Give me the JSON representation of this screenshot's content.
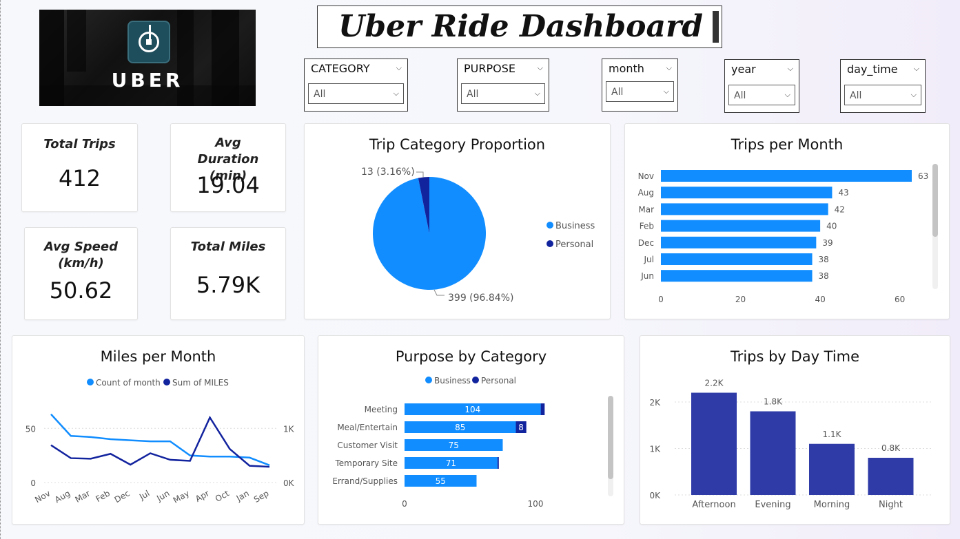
{
  "app": {
    "title": "Uber Ride Dashboard",
    "logo_text": "UBER"
  },
  "slicers": [
    {
      "label": "CATEGORY",
      "value": "All"
    },
    {
      "label": "PURPOSE",
      "value": "All"
    },
    {
      "label": "month",
      "value": "All"
    },
    {
      "label": "year",
      "value": "All"
    },
    {
      "label": "day_time",
      "value": "All"
    }
  ],
  "kpis": {
    "total_trips": {
      "label": "Total Trips",
      "value": "412"
    },
    "avg_duration": {
      "label": "Avg Duration (min)",
      "value": "19.04"
    },
    "avg_speed": {
      "label": "Avg Speed (km/h)",
      "value": "50.62"
    },
    "total_miles": {
      "label": "Total Miles",
      "value": "5.79K"
    }
  },
  "colors": {
    "business": "#118dff",
    "personal": "#12239e",
    "daytime_bar": "#2f3ca8"
  },
  "icons": {
    "dropdown": "chevron-down-icon",
    "logo": "uber-logo-icon"
  },
  "chart_data": [
    {
      "id": "trip_category",
      "type": "pie",
      "title": "Trip Category Proportion",
      "slices": [
        {
          "name": "Business",
          "value": 399,
          "label": "399 (96.84%)"
        },
        {
          "name": "Personal",
          "value": 13,
          "label": "13 (3.16%)"
        }
      ],
      "legend": [
        "Business",
        "Personal"
      ],
      "legend_position": "right"
    },
    {
      "id": "trips_per_month",
      "type": "bar",
      "orientation": "horizontal",
      "title": "Trips per Month",
      "categories": [
        "Nov",
        "Aug",
        "Mar",
        "Feb",
        "Dec",
        "Jul",
        "Jun"
      ],
      "values": [
        63,
        43,
        42,
        40,
        39,
        38,
        38
      ],
      "xticks": [
        "0",
        "20",
        "40",
        "60"
      ],
      "xlim": [
        0,
        63
      ]
    },
    {
      "id": "miles_per_month",
      "type": "line",
      "title": "Miles per Month",
      "legend": [
        "Count of month",
        "Sum of MILES"
      ],
      "legend_position": "top",
      "categories": [
        "Nov",
        "Aug",
        "Mar",
        "Feb",
        "Dec",
        "Jul",
        "Jun",
        "May",
        "Apr",
        "Oct",
        "Jan",
        "Sep"
      ],
      "series": [
        {
          "name": "Count of month",
          "axis": "left",
          "values": [
            63,
            43,
            42,
            40,
            39,
            38,
            38,
            25,
            24,
            24,
            23,
            16
          ]
        },
        {
          "name": "Sum of MILES",
          "axis": "right",
          "values": [
            690,
            450,
            440,
            530,
            330,
            540,
            420,
            400,
            1200,
            620,
            310,
            290
          ]
        }
      ],
      "yticks_left": [
        "0",
        "50"
      ],
      "yticks_right": [
        "0K",
        "1K"
      ],
      "ylim_left": [
        0,
        80
      ],
      "ylim_right": [
        0,
        1600
      ]
    },
    {
      "id": "purpose_by_category",
      "type": "bar",
      "orientation": "horizontal",
      "stacked": true,
      "title": "Purpose by Category",
      "legend": [
        "Business",
        "Personal"
      ],
      "legend_position": "top",
      "categories": [
        "Meeting",
        "Meal/Entertain",
        "Customer Visit",
        "Temporary Site",
        "Errand/Supplies"
      ],
      "series": [
        {
          "name": "Business",
          "values": [
            104,
            85,
            75,
            71,
            55
          ],
          "labels": [
            "104",
            "85",
            "75",
            "71",
            "55"
          ]
        },
        {
          "name": "Personal",
          "values": [
            3,
            8,
            0,
            1,
            0
          ],
          "labels": [
            "",
            "8",
            "",
            "",
            ""
          ]
        }
      ],
      "xticks": [
        "0",
        "100"
      ],
      "xlim": [
        0,
        100
      ]
    },
    {
      "id": "trips_by_day_time",
      "type": "bar",
      "title": "Trips by Day Time",
      "categories": [
        "Afternoon",
        "Evening",
        "Morning",
        "Night"
      ],
      "values": [
        2200,
        1800,
        1100,
        800
      ],
      "labels": [
        "2.2K",
        "1.8K",
        "1.1K",
        "0.8K"
      ],
      "yticks": [
        "0K",
        "1K",
        "2K"
      ],
      "ylim": [
        0,
        2000
      ]
    }
  ]
}
